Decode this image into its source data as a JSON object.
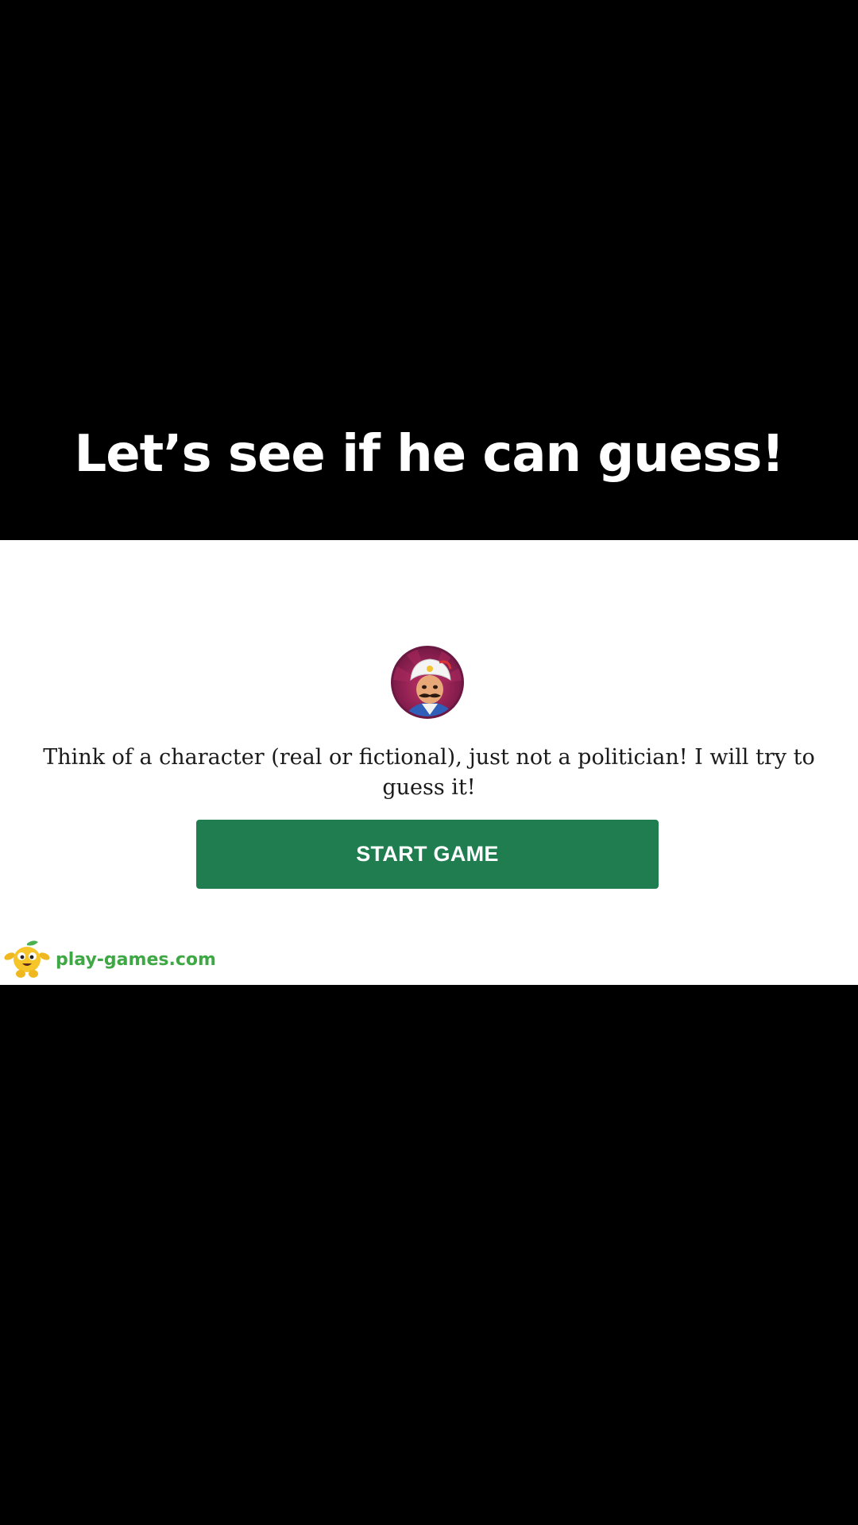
{
  "caption": {
    "text": "Let’s see if he can guess!"
  },
  "game": {
    "prompt": "Think of a character (real or fictional), just not a politician! I will try to guess it!",
    "start_button_label": "START GAME",
    "avatar_icon": "genie-avatar-icon"
  },
  "footer": {
    "site_name": "play-games.com",
    "logo_icon": "monster-mascot-icon"
  },
  "colors": {
    "background": "#000000",
    "panel": "#ffffff",
    "button": "#1f7d4f",
    "brand_text": "#3ea844"
  }
}
